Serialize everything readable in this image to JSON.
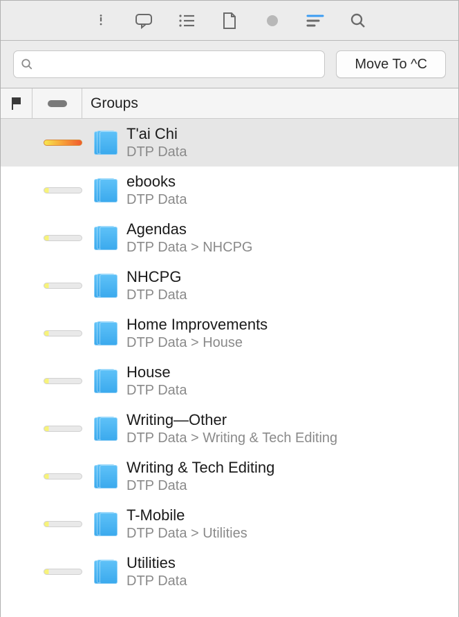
{
  "toolbar": {
    "icons": [
      "info-icon",
      "comment-icon",
      "list-icon",
      "document-icon",
      "dot-icon",
      "filter-icon",
      "search-icon"
    ]
  },
  "search": {
    "placeholder": ""
  },
  "move_button_label": "Move To ^C",
  "columns": {
    "groups_label": "Groups"
  },
  "rows": [
    {
      "title": "T'ai Chi",
      "path": "DTP Data",
      "hot": true,
      "selected": true
    },
    {
      "title": "ebooks",
      "path": "DTP Data",
      "hot": false,
      "selected": false
    },
    {
      "title": "Agendas",
      "path": "DTP Data > NHCPG",
      "hot": false,
      "selected": false
    },
    {
      "title": "NHCPG",
      "path": "DTP Data",
      "hot": false,
      "selected": false
    },
    {
      "title": "Home Improvements",
      "path": "DTP Data > House",
      "hot": false,
      "selected": false
    },
    {
      "title": "House",
      "path": "DTP Data",
      "hot": false,
      "selected": false
    },
    {
      "title": "Writing—Other",
      "path": "DTP Data > Writing & Tech Editing",
      "hot": false,
      "selected": false
    },
    {
      "title": "Writing & Tech Editing",
      "path": "DTP Data",
      "hot": false,
      "selected": false
    },
    {
      "title": "T-Mobile",
      "path": "DTP Data > Utilities",
      "hot": false,
      "selected": false
    },
    {
      "title": "Utilities",
      "path": "DTP Data",
      "hot": false,
      "selected": false
    }
  ]
}
